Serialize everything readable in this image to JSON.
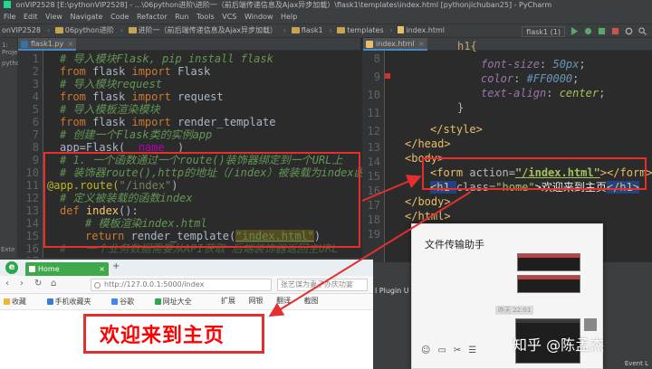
{
  "titlebar": {
    "text": "onVIP2528 [E:\\pythonVIP2528] - ...\\06python进阶\\进阶一（前后端传递信息及Ajax异步加载）\\flask1\\templates\\index.html [pythonjichuban25] - PyCharm"
  },
  "menu": [
    "File",
    "Edit",
    "View",
    "Navigate",
    "Code",
    "Refactor",
    "Run",
    "Tools",
    "VCS",
    "Window",
    "Help"
  ],
  "nav": {
    "crumbs": [
      "onVIP2528",
      "06python进阶",
      "进阶一（前后端传递信息及Ajax异步加载）",
      "flask1",
      "templates",
      "index.html"
    ],
    "run_config": "flask1 (1)"
  },
  "left_strip": [
    "1: Project",
    "pytho",
    "Exte"
  ],
  "editor_left": {
    "tab": "flask1.py",
    "line_numbers": [
      "1",
      "2",
      "3",
      "4",
      "5",
      "6",
      "7",
      "8",
      "9",
      "10",
      "11",
      "12",
      "13",
      "14",
      "15",
      "16",
      "17"
    ],
    "lines": {
      "l1": "# 导入模块Flask, pip install flask",
      "l2a": "from ",
      "l2b": "flask ",
      "l2c": "import ",
      "l2d": "Flask",
      "l3": "# 导入模块request",
      "l4a": "from ",
      "l4b": "flask ",
      "l4c": "import ",
      "l4d": "request",
      "l5": "# 导入模板渲染模块",
      "l6a": "from ",
      "l6b": "flask ",
      "l6c": "import ",
      "l6d": "render_template",
      "l7": "# 创建一个Flask类的实例app",
      "l8a": "app=Flask(",
      "l8b": "__name__",
      "l8c": ")",
      "l9": "# 1. 一个函数通过一个route()装饰器绑定到一个URL上",
      "l10": "# 装饰器route(),http的地址（/index）被装载为index函数",
      "l11a": "@app.route(",
      "l11b": "\"/index\"",
      "l11c": ")",
      "l12": "# 定义被装载的函数index",
      "l13a": "def ",
      "l13b": "index",
      "l13c": "():",
      "l14": "# 模板渲染index.html",
      "l15a": "return ",
      "l15b": "render_template(",
      "l15c": "\"index.html\"",
      "l15d": ")",
      "l16": "#   一个业务数据需要从API获取 后端装饰器返回主URL"
    }
  },
  "editor_right": {
    "tab": "index.html",
    "line_numbers": [
      "8",
      "9",
      "10",
      "11",
      "12",
      "13",
      "14",
      "15",
      "16",
      "17",
      "18",
      "19"
    ],
    "lines": {
      "r7": "h1{",
      "r8a": "font-size",
      "r8b": ": ",
      "r8c": "50px",
      "r8d": ";",
      "r9a": "color",
      "r9b": ": ",
      "r9c": "#FF0000",
      "r9d": ";",
      "r10a": "text-align",
      "r10b": ": ",
      "r10c": "center",
      "r10d": ";",
      "r11": "}",
      "r13": "</style>",
      "r14": "</head>",
      "r15": "<body>",
      "r16a": "<form ",
      "r16b": "action=",
      "r16c": "\"/index.html\"",
      "r16d": "></form>",
      "r17a": "<h1 ",
      "r17b": "class=",
      "r17c": "\"home\"",
      "r17d": ">欢迎来到主页",
      "r17e": "</h1>",
      "r18": "</body>",
      "r19": "</html>"
    }
  },
  "browser": {
    "tab_title": "Home",
    "url": "http://127.0.0.1:5000/index",
    "search_placeholder": "张艺谋为妻子办庆功宴",
    "bookmarks": [
      "收藏",
      "手机收藏夹",
      "谷歌",
      "网址大全"
    ],
    "page_heading": "欢迎来到主页",
    "toolbar_right": [
      "扩展",
      "网银",
      "翻译",
      "截图"
    ]
  },
  "plugin_text": "l Plugin U",
  "chat": {
    "title": "文件传输助手",
    "time_label": "昨天 22:01"
  },
  "watermark": "知乎 @陈孟杰",
  "event_log": "Event L",
  "colors": {
    "accent_red": "#e52f2f",
    "heading_red": "#ff0000",
    "browser_green": "#3ea84a"
  }
}
